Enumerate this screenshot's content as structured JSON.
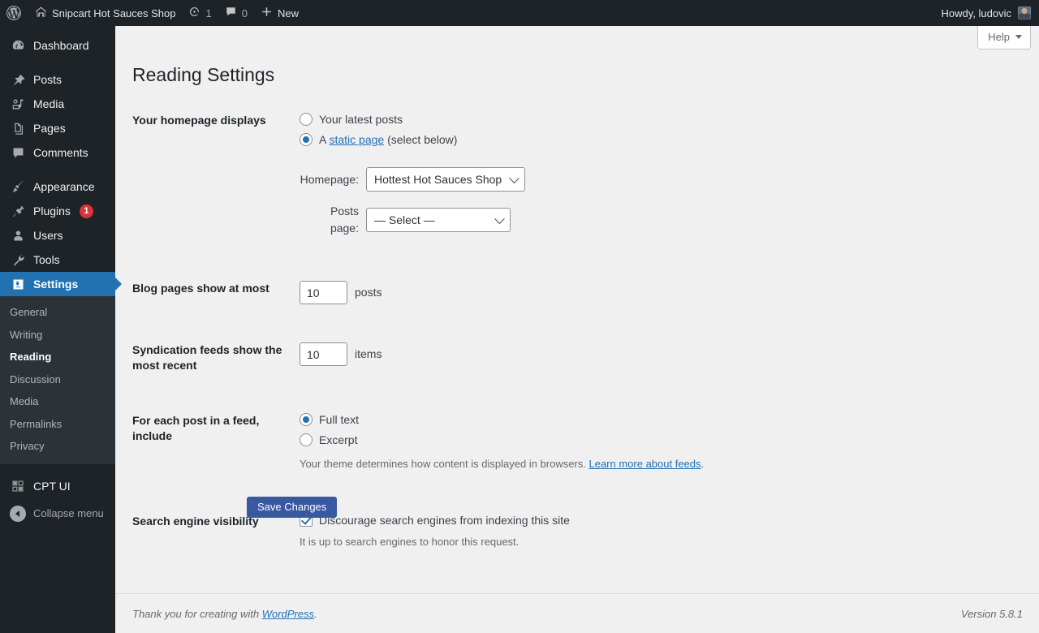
{
  "adminbar": {
    "logo_icon": "wordpress-logo-icon",
    "site_name": "Snipcart Hot Sauces Shop",
    "site_home_icon": "home-icon",
    "updates_icon": "updates-icon",
    "updates_count": "1",
    "comments_icon": "comment-bubble-icon",
    "comments_count": "0",
    "new_icon": "plus-icon",
    "new_label": "New",
    "howdy": "Howdy, ludovic",
    "avatar_icon": "user-avatar"
  },
  "sidebar": {
    "items": [
      {
        "label": "Dashboard",
        "icon": "dashboard-icon"
      },
      {
        "label": "Posts",
        "icon": "pin-icon"
      },
      {
        "label": "Media",
        "icon": "media-icon"
      },
      {
        "label": "Pages",
        "icon": "pages-icon"
      },
      {
        "label": "Comments",
        "icon": "comment-icon"
      },
      {
        "label": "Appearance",
        "icon": "brush-icon"
      },
      {
        "label": "Plugins",
        "icon": "plugin-icon",
        "badge": "1"
      },
      {
        "label": "Users",
        "icon": "user-icon"
      },
      {
        "label": "Tools",
        "icon": "wrench-icon"
      },
      {
        "label": "Settings",
        "icon": "settings-icon",
        "current": true
      }
    ],
    "settings_submenu": [
      {
        "label": "General"
      },
      {
        "label": "Writing"
      },
      {
        "label": "Reading",
        "current": true
      },
      {
        "label": "Discussion"
      },
      {
        "label": "Media"
      },
      {
        "label": "Permalinks"
      },
      {
        "label": "Privacy"
      }
    ],
    "cpt_ui": {
      "label": "CPT UI",
      "icon": "grid-squares-icon"
    },
    "collapse": {
      "label": "Collapse menu",
      "icon": "collapse-arrow-icon"
    },
    "colors": {
      "background": "#1d2327",
      "submenu_background": "#2c3338",
      "current_highlight": "#2271b1",
      "badge": "#d63638"
    }
  },
  "help_tab": {
    "label": "Help",
    "icon": "chevron-down-icon"
  },
  "page": {
    "title": "Reading Settings"
  },
  "homepage_displays": {
    "label": "Your homepage displays",
    "option_latest": "Your latest posts",
    "option_static_prefix": "A ",
    "option_static_link": "static page",
    "option_static_suffix": " (select below)",
    "selected": "static",
    "homepage_caption": "Homepage:",
    "homepage_value": "Hottest Hot Sauces Shop",
    "posts_page_caption": "Posts page:",
    "posts_page_value": "— Select —"
  },
  "blog_pages": {
    "label": "Blog pages show at most",
    "value": "10",
    "unit": "posts"
  },
  "syndication": {
    "label": "Syndication feeds show the most recent",
    "value": "10",
    "unit": "items"
  },
  "feed_include": {
    "label": "For each post in a feed, include",
    "option_full": "Full text",
    "option_excerpt": "Excerpt",
    "selected": "full",
    "help_prefix": "Your theme determines how content is displayed in browsers. ",
    "help_link": "Learn more about feeds",
    "help_suffix": "."
  },
  "search_visibility": {
    "label": "Search engine visibility",
    "checkbox_label": "Discourage search engines from indexing this site",
    "checked": true,
    "help": "It is up to search engines to honor this request."
  },
  "save": {
    "label": "Save Changes",
    "color": "#3858a0"
  },
  "footer": {
    "thanks_prefix": "Thank you for creating with ",
    "thanks_link": "WordPress",
    "thanks_suffix": ".",
    "version": "Version 5.8.1"
  }
}
